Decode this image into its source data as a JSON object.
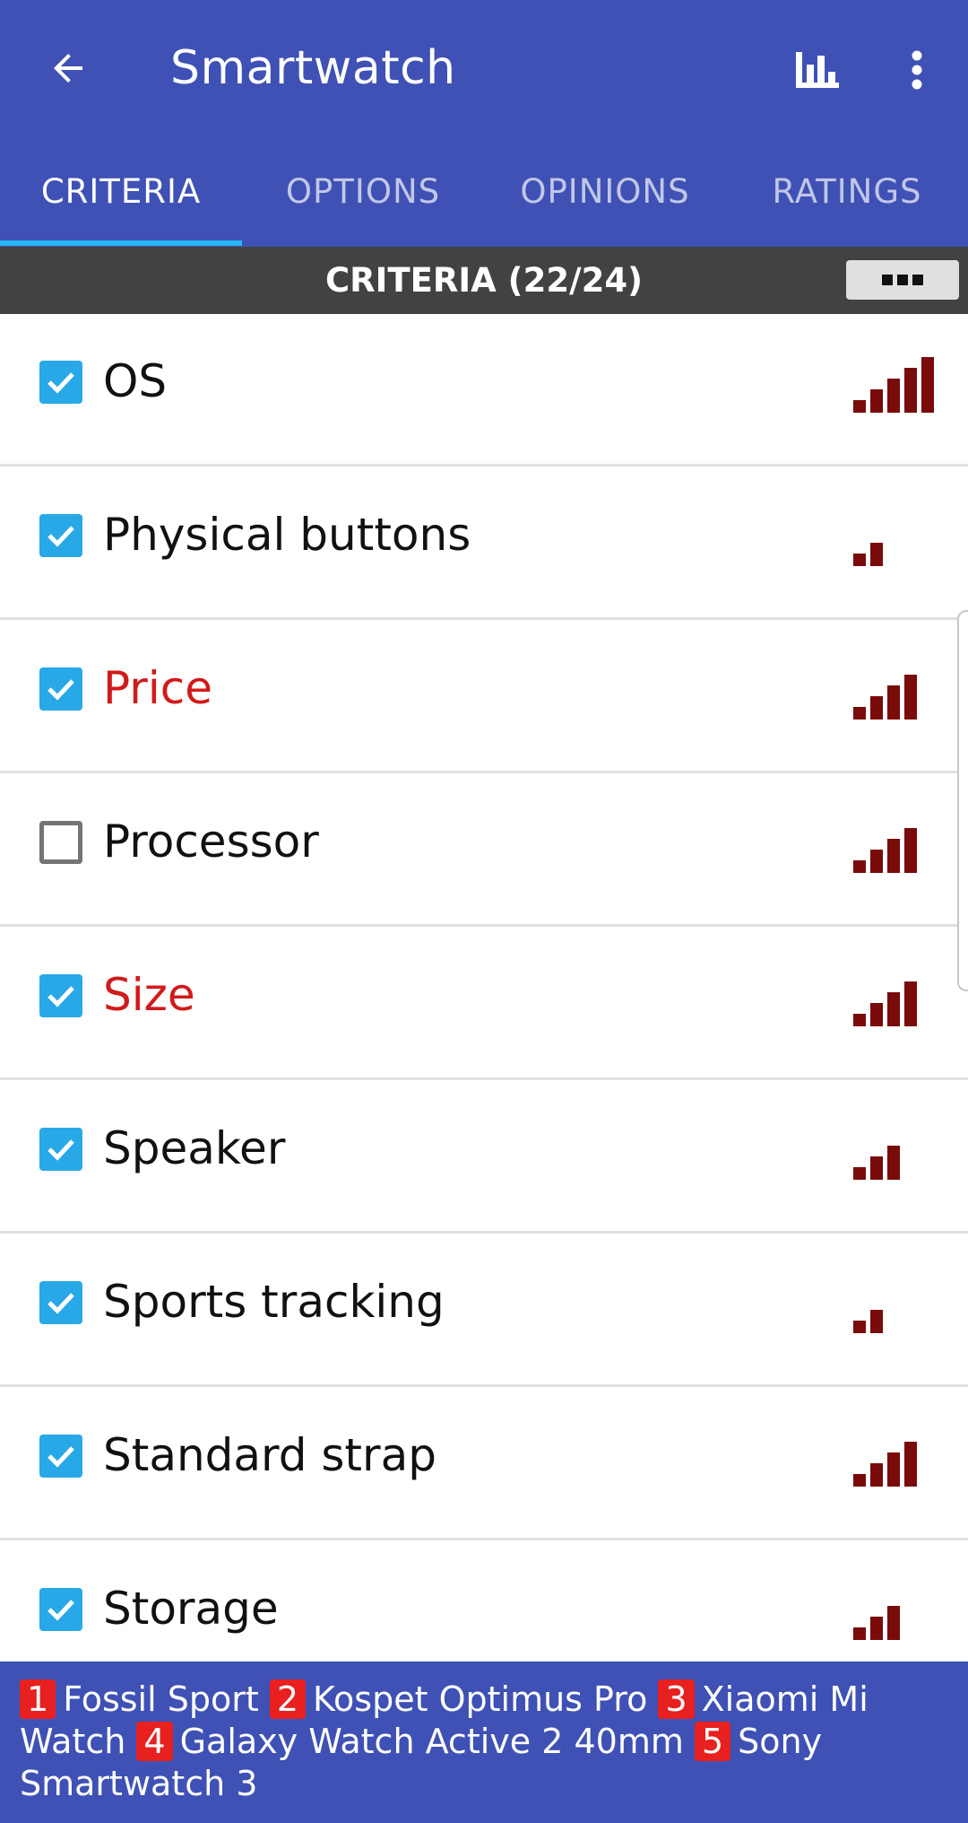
{
  "header": {
    "title": "Smartwatch",
    "back_icon": "arrow-back-icon",
    "chart_icon": "bar-chart-icon",
    "more_icon": "more-vert-icon",
    "background_color": "#3f51b5"
  },
  "tabs": [
    {
      "label": "CRITERIA",
      "active": true
    },
    {
      "label": "OPTIONS",
      "active": false
    },
    {
      "label": "OPINIONS",
      "active": false
    },
    {
      "label": "RATINGS",
      "active": false
    }
  ],
  "section": {
    "title": "CRITERIA (22/24)",
    "menu_icon": "three-squares-menu-icon"
  },
  "criteria": [
    {
      "label": "OS",
      "checked": true,
      "highlighted": false,
      "importance_level": 5
    },
    {
      "label": "Physical buttons",
      "checked": true,
      "highlighted": false,
      "importance_level": 2
    },
    {
      "label": "Price",
      "checked": true,
      "highlighted": true,
      "importance_level": 4
    },
    {
      "label": "Processor",
      "checked": false,
      "highlighted": false,
      "importance_level": 4
    },
    {
      "label": "Size",
      "checked": true,
      "highlighted": true,
      "importance_level": 4
    },
    {
      "label": "Speaker",
      "checked": true,
      "highlighted": false,
      "importance_level": 3
    },
    {
      "label": "Sports tracking",
      "checked": true,
      "highlighted": false,
      "importance_level": 2
    },
    {
      "label": "Standard strap",
      "checked": true,
      "highlighted": false,
      "importance_level": 4
    },
    {
      "label": "Storage",
      "checked": true,
      "highlighted": false,
      "importance_level": 3
    }
  ],
  "ranking": [
    {
      "rank": "1",
      "name": "Fossil Sport"
    },
    {
      "rank": "2",
      "name": "Kospet Optimus Pro"
    },
    {
      "rank": "3",
      "name": "Xiaomi Mi Watch"
    },
    {
      "rank": "4",
      "name": "Galaxy Watch Active 2 40mm"
    },
    {
      "rank": "5",
      "name": "Sony Smartwatch 3"
    }
  ],
  "colors": {
    "accent": "#29b6f6",
    "checkbox": "#29a8e8",
    "highlight_text": "#d11a1a",
    "importance_bar": "#7a0b0b",
    "rank_badge": "#e82020",
    "section_bar": "#424242"
  }
}
